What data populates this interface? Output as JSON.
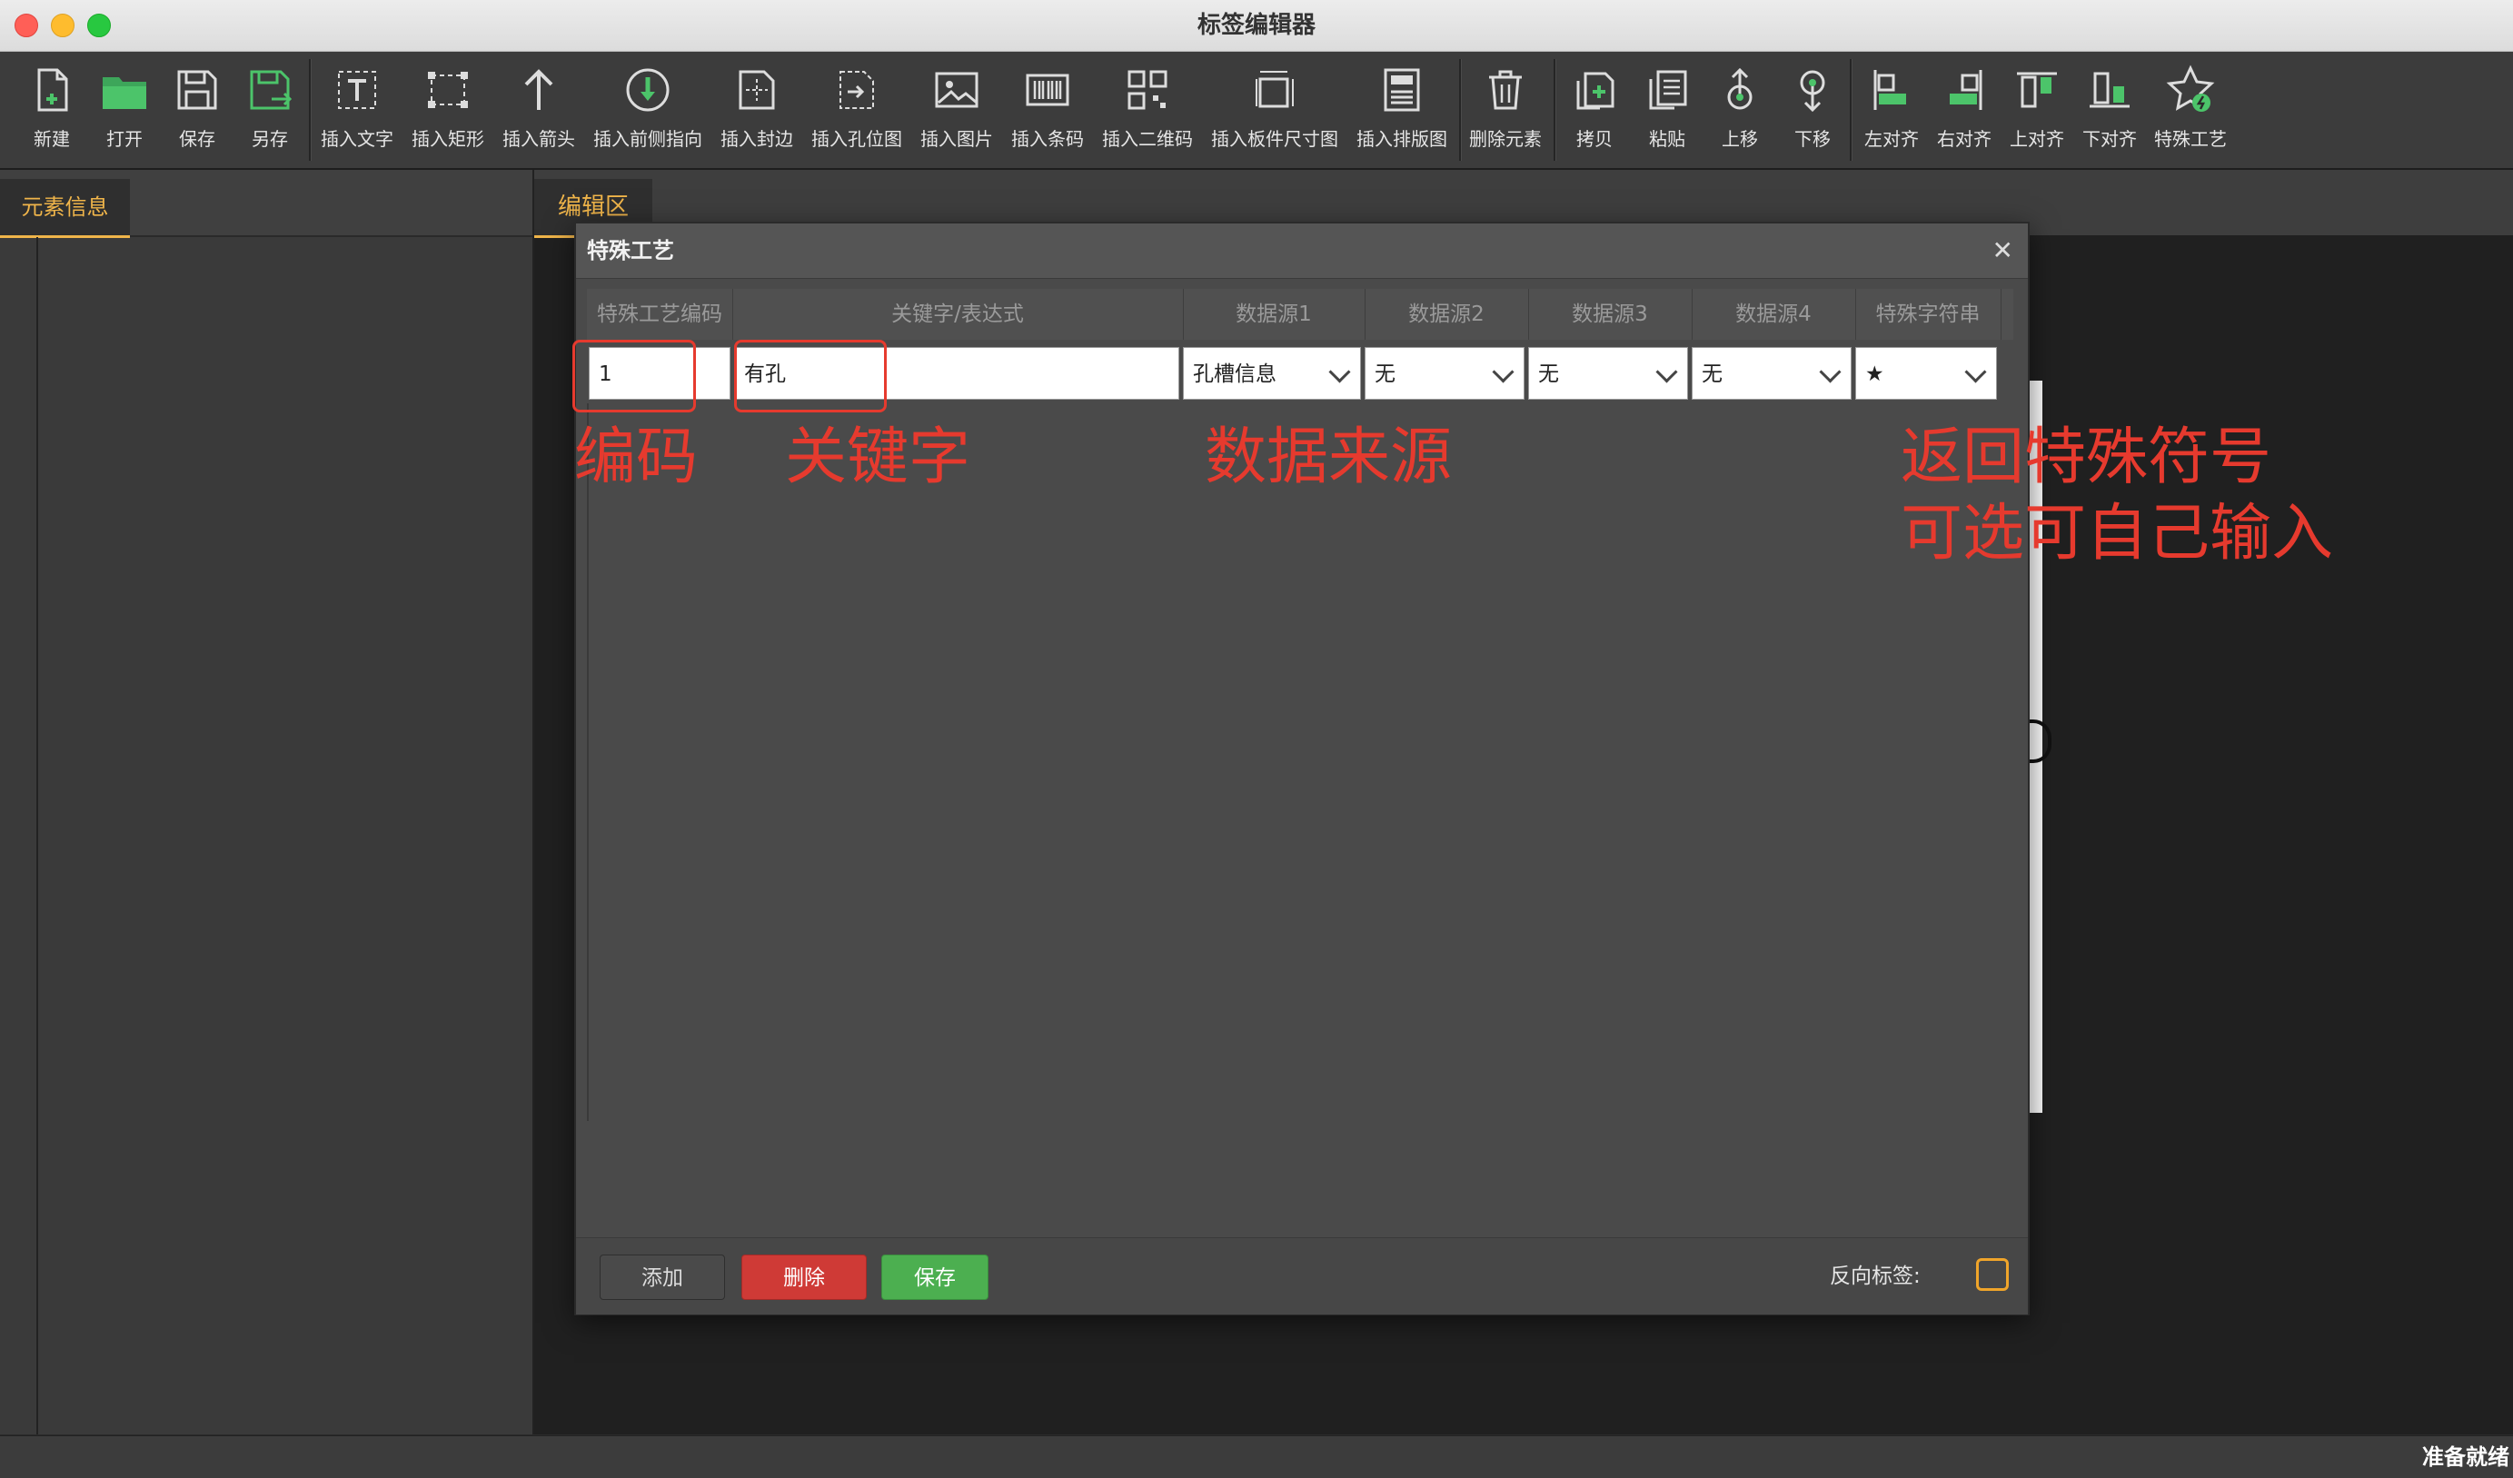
{
  "window": {
    "title": "标签编辑器"
  },
  "toolbar": {
    "items": [
      {
        "label": "新建",
        "icon": "new-file-icon"
      },
      {
        "label": "打开",
        "icon": "open-folder-icon"
      },
      {
        "label": "保存",
        "icon": "save-icon"
      },
      {
        "label": "另存",
        "icon": "save-as-icon"
      },
      {
        "label": "插入文字",
        "icon": "insert-text-icon"
      },
      {
        "label": "插入矩形",
        "icon": "insert-rect-icon"
      },
      {
        "label": "插入箭头",
        "icon": "insert-arrow-icon"
      },
      {
        "label": "插入前侧指向",
        "icon": "insert-front-pointer-icon"
      },
      {
        "label": "插入封边",
        "icon": "insert-edge-band-icon"
      },
      {
        "label": "插入孔位图",
        "icon": "insert-hole-map-icon"
      },
      {
        "label": "插入图片",
        "icon": "insert-image-icon"
      },
      {
        "label": "插入条码",
        "icon": "insert-barcode-icon"
      },
      {
        "label": "插入二维码",
        "icon": "insert-qrcode-icon"
      },
      {
        "label": "插入板件尺寸图",
        "icon": "insert-panel-size-icon"
      },
      {
        "label": "插入排版图",
        "icon": "insert-layout-icon"
      },
      {
        "label": "删除元素",
        "icon": "delete-element-icon"
      },
      {
        "label": "拷贝",
        "icon": "copy-icon"
      },
      {
        "label": "粘贴",
        "icon": "paste-icon"
      },
      {
        "label": "上移",
        "icon": "move-up-icon"
      },
      {
        "label": "下移",
        "icon": "move-down-icon"
      },
      {
        "label": "左对齐",
        "icon": "align-left-icon"
      },
      {
        "label": "右对齐",
        "icon": "align-right-icon"
      },
      {
        "label": "上对齐",
        "icon": "align-top-icon"
      },
      {
        "label": "下对齐",
        "icon": "align-bottom-icon"
      },
      {
        "label": "特殊工艺",
        "icon": "special-process-icon"
      }
    ]
  },
  "left_panel": {
    "tab_label": "元素信息"
  },
  "editor": {
    "tab_label": "编辑区"
  },
  "dialog": {
    "title": "特殊工艺",
    "close_glyph": "✕",
    "columns": [
      "特殊工艺编码",
      "关键字/表达式",
      "数据源1",
      "数据源2",
      "数据源3",
      "数据源4",
      "特殊字符串"
    ],
    "row": {
      "code": "1",
      "keyword": "有孔",
      "source1": "孔槽信息",
      "source2": "无",
      "source3": "无",
      "source4": "无",
      "special_string": "★"
    },
    "footer": {
      "add_label": "添加",
      "delete_label": "删除",
      "save_label": "保存",
      "reverse_label": "反向标签:"
    }
  },
  "annotations": {
    "code": "编码",
    "keyword": "关键字",
    "source": "数据来源",
    "special_line1": "返回特殊符号",
    "special_line2": "可选可自己输入"
  },
  "status": {
    "text": "准备就绪"
  },
  "colors": {
    "accent_orange": "#f0b54a",
    "annotation_red": "#e63a2e",
    "delete_red": "#cf3a36",
    "save_green": "#4caf50",
    "icon_green": "#4cc46a"
  }
}
